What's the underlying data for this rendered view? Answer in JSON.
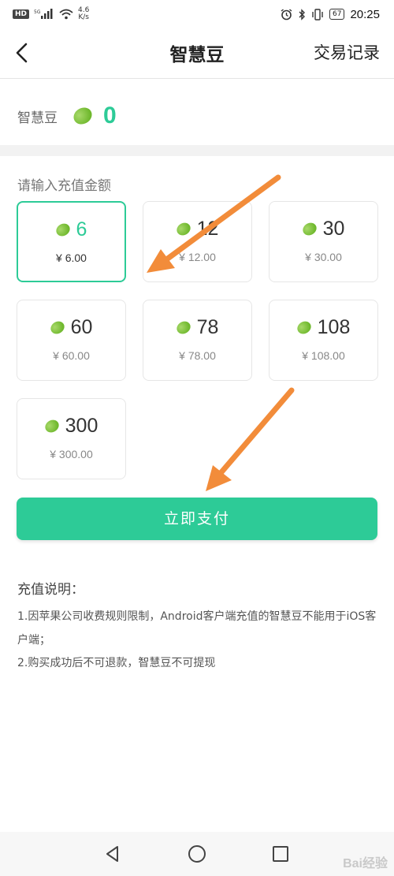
{
  "status_bar": {
    "hd": "HD",
    "signal_label": "5G",
    "net_speed_value": "4.6",
    "net_speed_unit": "K/s",
    "battery": "67",
    "time": "20:25"
  },
  "nav": {
    "title": "智慧豆",
    "record_link": "交易记录"
  },
  "balance": {
    "label": "智慧豆",
    "value": "0"
  },
  "recharge": {
    "section_label": "请输入充值金额",
    "options": [
      {
        "amount": "6",
        "price": "¥ 6.00",
        "selected": true
      },
      {
        "amount": "12",
        "price": "¥ 12.00",
        "selected": false
      },
      {
        "amount": "30",
        "price": "¥ 30.00",
        "selected": false
      },
      {
        "amount": "60",
        "price": "¥ 60.00",
        "selected": false
      },
      {
        "amount": "78",
        "price": "¥ 78.00",
        "selected": false
      },
      {
        "amount": "108",
        "price": "¥ 108.00",
        "selected": false
      },
      {
        "amount": "300",
        "price": "¥ 300.00",
        "selected": false
      }
    ]
  },
  "pay_button": "立即支付",
  "notes": {
    "title": "充值说明：",
    "lines": [
      "1.因苹果公司收费规则限制，Android客户端充值的智慧豆不能用于iOS客户端；",
      "2.购买成功后不可退款，智慧豆不可提现"
    ]
  },
  "watermark": "Bai经验",
  "colors": {
    "accent": "#2dcb97",
    "bean": "#7cc23a",
    "annotation_arrow": "#f28c3a"
  },
  "icons": {
    "back": "chevron-left-icon",
    "bean": "bean-icon",
    "nav_back": "triangle-back-icon",
    "nav_home": "circle-home-icon",
    "nav_recent": "square-recent-icon"
  }
}
